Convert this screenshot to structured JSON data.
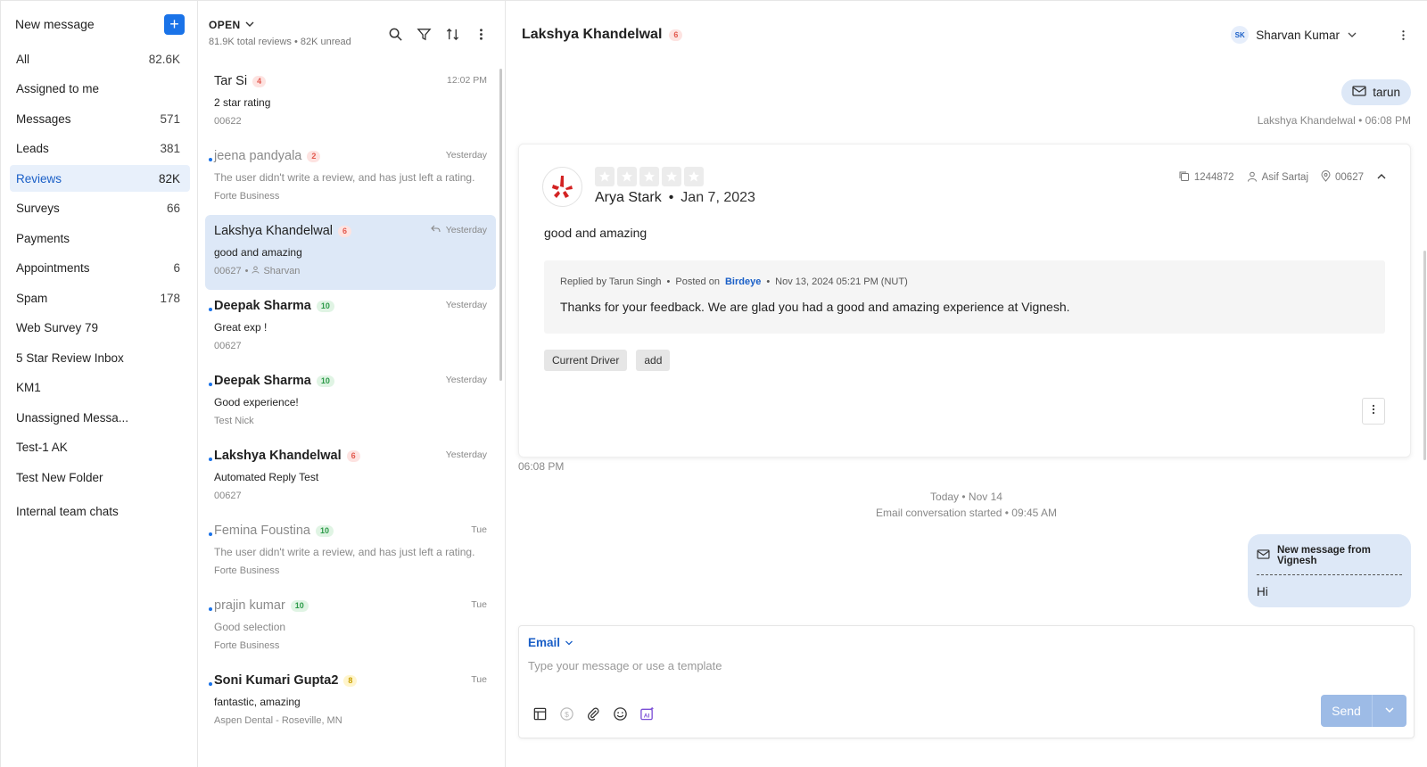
{
  "sidebar": {
    "new_message_label": "New message",
    "items": [
      {
        "label": "All",
        "count": "82.6K"
      },
      {
        "label": "Assigned to me",
        "count": ""
      },
      {
        "label": "Messages",
        "count": "571"
      },
      {
        "label": "Leads",
        "count": "381"
      },
      {
        "label": "Reviews",
        "count": "82K"
      },
      {
        "label": "Surveys",
        "count": "66"
      },
      {
        "label": "Payments",
        "count": ""
      },
      {
        "label": "Appointments",
        "count": "6"
      },
      {
        "label": "Spam",
        "count": "178"
      },
      {
        "label": "Web Survey 79",
        "count": ""
      },
      {
        "label": "5 Star Review Inbox",
        "count": ""
      },
      {
        "label": "KM1",
        "count": ""
      },
      {
        "label": "Unassigned Messa...",
        "count": ""
      },
      {
        "label": "Test-1 AK",
        "count": ""
      },
      {
        "label": "Test New Folder",
        "count": ""
      }
    ],
    "internal_label": "Internal team chats"
  },
  "list": {
    "filter_label": "OPEN",
    "summary": "81.9K total reviews • 82K unread",
    "cards": [
      {
        "name": "Tar Si",
        "badge": "4",
        "time": "12:02 PM",
        "line2": "2 star rating",
        "line3": "00622"
      },
      {
        "name": "jeena pandyala",
        "badge": "2",
        "time": "Yesterday",
        "line2": "The user didn't write a review, and has just left a rating.",
        "line3": "Forte Business"
      },
      {
        "name": "Lakshya Khandelwal",
        "badge": "6",
        "time": "Yesterday",
        "line2": "good and amazing",
        "line3": "00627",
        "line3_sep": "•",
        "line3_user": "Sharvan"
      },
      {
        "name": "Deepak Sharma",
        "badge": "10",
        "time": "Yesterday",
        "line2": "Great exp !",
        "line3": "00627"
      },
      {
        "name": "Deepak Sharma",
        "badge": "10",
        "time": "Yesterday",
        "line2": "Good experience!",
        "line3": "Test Nick"
      },
      {
        "name": "Lakshya Khandelwal",
        "badge": "6",
        "time": "Yesterday",
        "line2": "Automated Reply Test",
        "line3": "00627"
      },
      {
        "name": "Femina Foustina",
        "badge": "10",
        "time": "Tue",
        "line2": "The user didn't write a review, and has just left a rating.",
        "line3": "Forte Business"
      },
      {
        "name": "prajin kumar",
        "badge": "10",
        "time": "Tue",
        "line2": "Good selection",
        "line3": "Forte Business"
      },
      {
        "name": "Soni Kumari Gupta2",
        "badge": "8",
        "time": "Tue",
        "line2": "fantastic, amazing",
        "line3": "Aspen Dental - Roseville, MN"
      }
    ]
  },
  "conversation": {
    "contact_name": "Lakshya Khandelwal",
    "contact_badge": "6",
    "assignee_initials": "SK",
    "assignee_name": "Sharvan Kumar",
    "tag_label": "tarun",
    "tag_meta": "Lakshya Khandelwal • 06:08 PM",
    "review": {
      "reviewer": "Arya Stark",
      "dot": "•",
      "date": "Jan 7, 2023",
      "review_id": "1244872",
      "owner": "Asif Sartaj",
      "location": "00627",
      "text": "good and amazing",
      "reply_by": "Replied by Tarun Singh",
      "posted_on": "Posted on",
      "posted_link": "Birdeye",
      "reply_date": "Nov 13, 2024 05:21 PM (NUT)",
      "reply_text": "Thanks for your feedback. We are glad you had a good and amazing experience at Vignesh.",
      "chips": [
        "Current Driver",
        "add"
      ],
      "stars": 0
    },
    "review_time": "06:08 PM",
    "system_note_1": "Today • Nov 14",
    "system_note_2": "Email conversation started • 09:45 AM",
    "email_bubble_title": "New message from Vignesh",
    "email_bubble_body": "Hi"
  },
  "composer": {
    "channel": "Email",
    "placeholder": "Type your message or use a template",
    "send_label": "Send"
  },
  "colors": {
    "accent": "#1a73e8",
    "selected_bg": "#dde8f7",
    "yelp_red": "#d32323"
  }
}
